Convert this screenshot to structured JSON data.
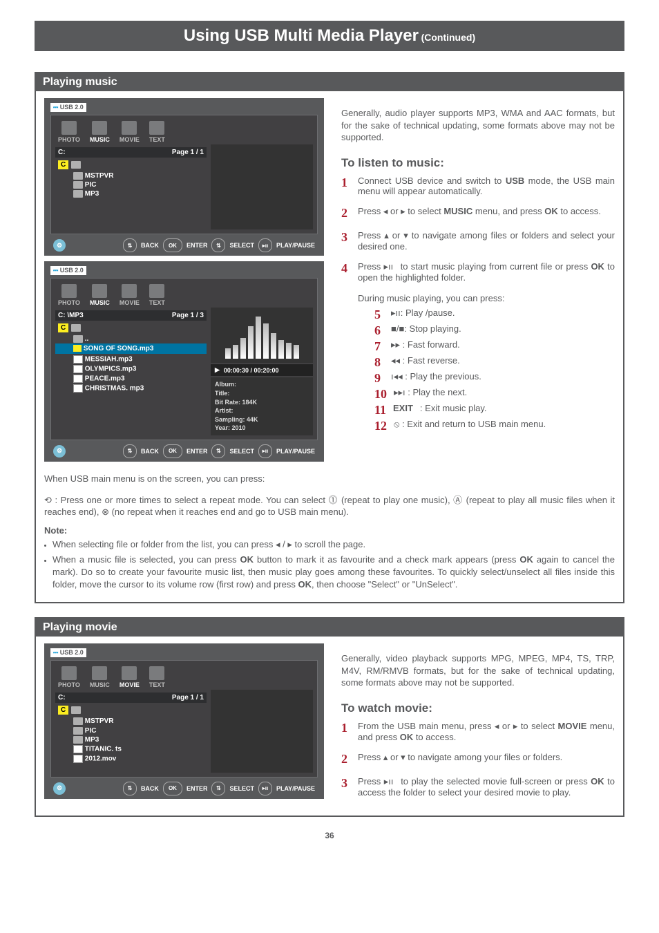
{
  "title": {
    "main": "Using USB Multi Media Player",
    "cont": "(Continued)"
  },
  "music": {
    "hdr": "Playing music",
    "usb": "USB 2.0",
    "tabs": {
      "photo": "PHOTO",
      "music": "MUSIC",
      "movie": "MOVIE",
      "text": "TEXT"
    },
    "ss1": {
      "path": "C:",
      "page": "Page 1 / 1",
      "drive": "C",
      "folders": [
        "MSTPVR",
        "PIC",
        "MP3"
      ]
    },
    "ss2": {
      "path": "C:   \\MP3",
      "page": "Page 1 / 3",
      "drive": "C",
      "up": "..",
      "hl": "SONG OF SONG.mp3",
      "files": [
        "MESSIAH.mp3",
        "OLYMPICS.mp3",
        "PEACE.mp3",
        "CHRISTMAS. mp3"
      ],
      "time": "00:00:30  /  00:20:00",
      "meta": {
        "album": "Album:",
        "title": "Title:",
        "bitrate": "Bit Rate:  184K",
        "artist": "Artist:",
        "sampling": "Sampling: 44K",
        "year": "Year:  2010"
      }
    },
    "hint": {
      "back": "BACK",
      "ok": "OK",
      "enter": "ENTER",
      "select": "SELECT",
      "play": "PLAY/PAUSE"
    },
    "intro": "Generally, audio player supports MP3, WMA and AAC formats, but for the sake of technical updating, some formats above may not be supported.",
    "h": "To listen to music:",
    "s1": "Connect USB device and switch to USB mode, the USB main menu will appear automatically.",
    "s2": "Press ◂ or ▸ to select MUSIC menu, and press OK to access.",
    "s3": "Press ▴ or ▾ to navigate among files or folders and select your desired one.",
    "s4": "Press ▸ıı to start music playing from current file or press OK to open the highlighted folder.",
    "s4b": "During music playing, you can press:",
    "ctrl": {
      "pp": "▸ıı: Play /pause.",
      "stop": "■/■: Stop playing.",
      "ff": "▸▸ : Fast forward.",
      "fr": "◂◂ : Fast reverse.",
      "prev": "ı◂◂ : Play the previous.",
      "next": "▸▸ı : Play the next.",
      "exit": "EXIT: Exit music play.",
      "ret": "⦸ : Exit and return to USB main menu."
    },
    "footer1": "When USB main menu is on the screen, you can press:",
    "footer2": "⟲ : Press one or more times to select a repeat mode. You can select ⓵ (repeat to play one music), Ⓐ (repeat to play all music files when it reaches end), ⊗ (no repeat when it reaches end and go to USB main menu).",
    "note": "Note:",
    "b1": "When selecting file or folder from the list, you can  press ◂ / ▸ to scroll the page.",
    "b2": "When a music file is selected, you can press OK button to mark it as favourite and a check mark appears (press OK again to cancel the mark). Do so to create your favourite music list, then music play goes among these favourites. To quickly select/unselect all files inside this folder, move the cursor to its volume row (first row) and press OK, then choose \"Select\" or \"UnSelect\"."
  },
  "movie": {
    "hdr": "Playing movie",
    "usb": "USB 2.0",
    "ss": {
      "path": "C:",
      "page": "Page 1 / 1",
      "drive": "C",
      "folders": [
        "MSTPVR",
        "PIC",
        "MP3"
      ],
      "files": [
        "TITANIC. ts",
        "2012.mov"
      ]
    },
    "intro": "Generally, video playback supports MPG, MPEG, MP4, TS, TRP, M4V, RM/RMVB formats, but for the sake of technical updating, some formats above may not be supported.",
    "h": "To watch movie:",
    "s1": "From the USB main menu, press ◂ or ▸ to select MOVIE menu, and press OK to access.",
    "s2": "Press ▴ or ▾ to navigate among your files or folders.",
    "s3": "Press ▸ıı to play the selected movie full-screen or press OK to access the folder to select your desired movie to play."
  },
  "pagenum": "36"
}
